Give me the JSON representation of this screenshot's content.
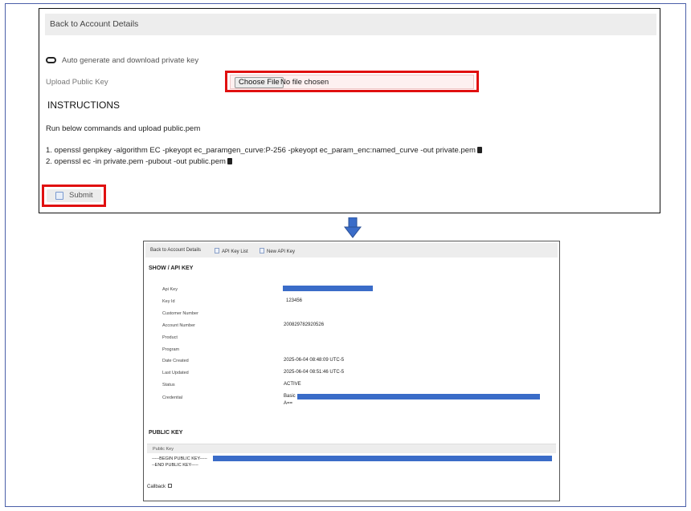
{
  "top": {
    "header_link": "Back to Account Details",
    "auto_generate_label": "Auto generate and download private key",
    "upload_label": "Upload Public Key",
    "choose_file_button": "Choose File",
    "no_file_text": "No file chosen",
    "instructions_title": "INSTRUCTIONS",
    "run_text": "Run below commands and upload public.pem",
    "commands": [
      "1. openssl genpkey -algorithm EC -pkeyopt ec_paramgen_curve:P-256 -pkeyopt ec_param_enc:named_curve -out private.pem",
      "2. openssl ec -in private.pem -pubout -out public.pem"
    ],
    "submit_label": "Submit"
  },
  "bottom": {
    "nav": {
      "back": "Back to Account Details",
      "api_key_list": "API Key List",
      "new_api_key": "New API Key"
    },
    "title": "SHOW / API KEY",
    "fields": {
      "api_key_label": "Api Key",
      "key_id_label": "Key Id",
      "key_id_value": "123456",
      "customer_number_label": "Customer Number",
      "account_number_label": "Account Number",
      "account_number_value": "200829782920526",
      "product_label": "Product",
      "program_label": "Program",
      "date_created_label": "Date Created",
      "date_created_value": "2025-06-04 08:48:09 UTC-5",
      "last_updated_label": "Last Updated",
      "last_updated_value": "2025-06-04 08:51:46 UTC-5",
      "status_label": "Status",
      "status_value": "ACTIVE",
      "credential_label": "Credential",
      "credential_prefix": "Basic",
      "credential_suffix": "A=="
    },
    "public_key_title": "PUBLIC KEY",
    "public_key_header": "Public Key",
    "begin_line": "-----BEGIN PUBLIC KEY-----",
    "end_line": "--END PUBLIC KEY-----",
    "callback_label": "Callback"
  },
  "colors": {
    "highlight_border": "#e01010",
    "redaction": "#3a6cc8",
    "arrow": "#3a6cc8"
  }
}
